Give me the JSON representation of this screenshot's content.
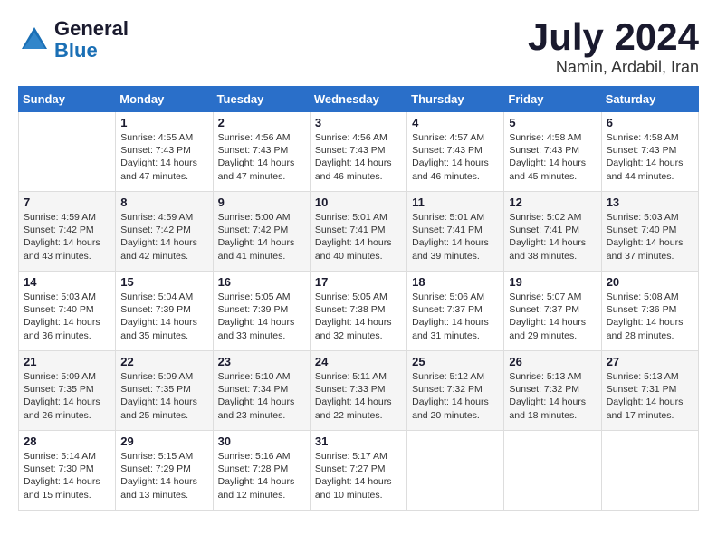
{
  "header": {
    "logo_line1": "General",
    "logo_line2": "Blue",
    "month_year": "July 2024",
    "location": "Namin, Ardabil, Iran"
  },
  "weekdays": [
    "Sunday",
    "Monday",
    "Tuesday",
    "Wednesday",
    "Thursday",
    "Friday",
    "Saturday"
  ],
  "weeks": [
    [
      {
        "day": "",
        "sunrise": "",
        "sunset": "",
        "daylight": ""
      },
      {
        "day": "1",
        "sunrise": "Sunrise: 4:55 AM",
        "sunset": "Sunset: 7:43 PM",
        "daylight": "Daylight: 14 hours and 47 minutes."
      },
      {
        "day": "2",
        "sunrise": "Sunrise: 4:56 AM",
        "sunset": "Sunset: 7:43 PM",
        "daylight": "Daylight: 14 hours and 47 minutes."
      },
      {
        "day": "3",
        "sunrise": "Sunrise: 4:56 AM",
        "sunset": "Sunset: 7:43 PM",
        "daylight": "Daylight: 14 hours and 46 minutes."
      },
      {
        "day": "4",
        "sunrise": "Sunrise: 4:57 AM",
        "sunset": "Sunset: 7:43 PM",
        "daylight": "Daylight: 14 hours and 46 minutes."
      },
      {
        "day": "5",
        "sunrise": "Sunrise: 4:58 AM",
        "sunset": "Sunset: 7:43 PM",
        "daylight": "Daylight: 14 hours and 45 minutes."
      },
      {
        "day": "6",
        "sunrise": "Sunrise: 4:58 AM",
        "sunset": "Sunset: 7:43 PM",
        "daylight": "Daylight: 14 hours and 44 minutes."
      }
    ],
    [
      {
        "day": "7",
        "sunrise": "Sunrise: 4:59 AM",
        "sunset": "Sunset: 7:42 PM",
        "daylight": "Daylight: 14 hours and 43 minutes."
      },
      {
        "day": "8",
        "sunrise": "Sunrise: 4:59 AM",
        "sunset": "Sunset: 7:42 PM",
        "daylight": "Daylight: 14 hours and 42 minutes."
      },
      {
        "day": "9",
        "sunrise": "Sunrise: 5:00 AM",
        "sunset": "Sunset: 7:42 PM",
        "daylight": "Daylight: 14 hours and 41 minutes."
      },
      {
        "day": "10",
        "sunrise": "Sunrise: 5:01 AM",
        "sunset": "Sunset: 7:41 PM",
        "daylight": "Daylight: 14 hours and 40 minutes."
      },
      {
        "day": "11",
        "sunrise": "Sunrise: 5:01 AM",
        "sunset": "Sunset: 7:41 PM",
        "daylight": "Daylight: 14 hours and 39 minutes."
      },
      {
        "day": "12",
        "sunrise": "Sunrise: 5:02 AM",
        "sunset": "Sunset: 7:41 PM",
        "daylight": "Daylight: 14 hours and 38 minutes."
      },
      {
        "day": "13",
        "sunrise": "Sunrise: 5:03 AM",
        "sunset": "Sunset: 7:40 PM",
        "daylight": "Daylight: 14 hours and 37 minutes."
      }
    ],
    [
      {
        "day": "14",
        "sunrise": "Sunrise: 5:03 AM",
        "sunset": "Sunset: 7:40 PM",
        "daylight": "Daylight: 14 hours and 36 minutes."
      },
      {
        "day": "15",
        "sunrise": "Sunrise: 5:04 AM",
        "sunset": "Sunset: 7:39 PM",
        "daylight": "Daylight: 14 hours and 35 minutes."
      },
      {
        "day": "16",
        "sunrise": "Sunrise: 5:05 AM",
        "sunset": "Sunset: 7:39 PM",
        "daylight": "Daylight: 14 hours and 33 minutes."
      },
      {
        "day": "17",
        "sunrise": "Sunrise: 5:05 AM",
        "sunset": "Sunset: 7:38 PM",
        "daylight": "Daylight: 14 hours and 32 minutes."
      },
      {
        "day": "18",
        "sunrise": "Sunrise: 5:06 AM",
        "sunset": "Sunset: 7:37 PM",
        "daylight": "Daylight: 14 hours and 31 minutes."
      },
      {
        "day": "19",
        "sunrise": "Sunrise: 5:07 AM",
        "sunset": "Sunset: 7:37 PM",
        "daylight": "Daylight: 14 hours and 29 minutes."
      },
      {
        "day": "20",
        "sunrise": "Sunrise: 5:08 AM",
        "sunset": "Sunset: 7:36 PM",
        "daylight": "Daylight: 14 hours and 28 minutes."
      }
    ],
    [
      {
        "day": "21",
        "sunrise": "Sunrise: 5:09 AM",
        "sunset": "Sunset: 7:35 PM",
        "daylight": "Daylight: 14 hours and 26 minutes."
      },
      {
        "day": "22",
        "sunrise": "Sunrise: 5:09 AM",
        "sunset": "Sunset: 7:35 PM",
        "daylight": "Daylight: 14 hours and 25 minutes."
      },
      {
        "day": "23",
        "sunrise": "Sunrise: 5:10 AM",
        "sunset": "Sunset: 7:34 PM",
        "daylight": "Daylight: 14 hours and 23 minutes."
      },
      {
        "day": "24",
        "sunrise": "Sunrise: 5:11 AM",
        "sunset": "Sunset: 7:33 PM",
        "daylight": "Daylight: 14 hours and 22 minutes."
      },
      {
        "day": "25",
        "sunrise": "Sunrise: 5:12 AM",
        "sunset": "Sunset: 7:32 PM",
        "daylight": "Daylight: 14 hours and 20 minutes."
      },
      {
        "day": "26",
        "sunrise": "Sunrise: 5:13 AM",
        "sunset": "Sunset: 7:32 PM",
        "daylight": "Daylight: 14 hours and 18 minutes."
      },
      {
        "day": "27",
        "sunrise": "Sunrise: 5:13 AM",
        "sunset": "Sunset: 7:31 PM",
        "daylight": "Daylight: 14 hours and 17 minutes."
      }
    ],
    [
      {
        "day": "28",
        "sunrise": "Sunrise: 5:14 AM",
        "sunset": "Sunset: 7:30 PM",
        "daylight": "Daylight: 14 hours and 15 minutes."
      },
      {
        "day": "29",
        "sunrise": "Sunrise: 5:15 AM",
        "sunset": "Sunset: 7:29 PM",
        "daylight": "Daylight: 14 hours and 13 minutes."
      },
      {
        "day": "30",
        "sunrise": "Sunrise: 5:16 AM",
        "sunset": "Sunset: 7:28 PM",
        "daylight": "Daylight: 14 hours and 12 minutes."
      },
      {
        "day": "31",
        "sunrise": "Sunrise: 5:17 AM",
        "sunset": "Sunset: 7:27 PM",
        "daylight": "Daylight: 14 hours and 10 minutes."
      },
      {
        "day": "",
        "sunrise": "",
        "sunset": "",
        "daylight": ""
      },
      {
        "day": "",
        "sunrise": "",
        "sunset": "",
        "daylight": ""
      },
      {
        "day": "",
        "sunrise": "",
        "sunset": "",
        "daylight": ""
      }
    ]
  ]
}
